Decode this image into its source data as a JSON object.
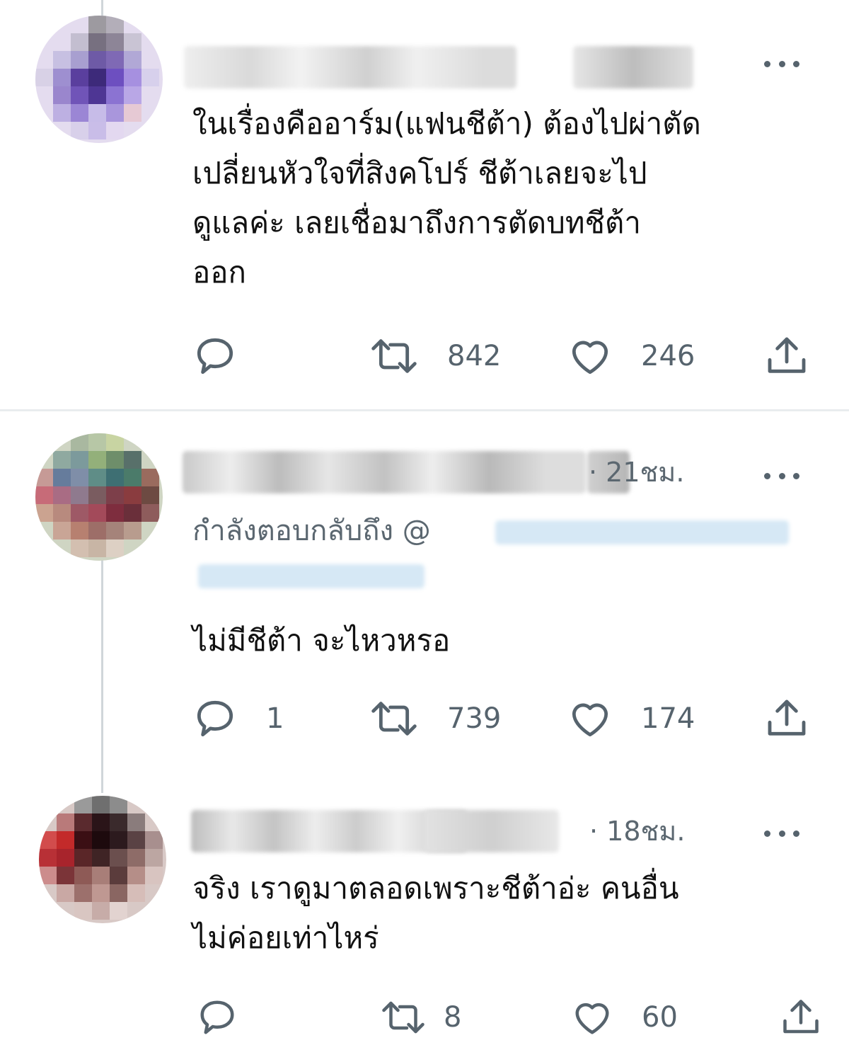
{
  "tweets": [
    {
      "time": "",
      "text": "ในเรื่องคืออาร์ม(แฟนชีต้า) ต้องไปผ่าตัด\nเปลี่ยนหัวใจที่สิงคโปร์ ชีต้าเลยจะไป\nดูแลค่ะ เลยเชื่อมาถึงการตัดบทชีต้า\nออก",
      "replies": "",
      "retweets": "842",
      "likes": "246"
    },
    {
      "time": "· 21ชม.",
      "reply_prefix": "กำลังตอบกลับถึง @",
      "text": "ไม่มีชีต้า  จะไหวหรอ",
      "replies": "1",
      "retweets": "739",
      "likes": "174"
    },
    {
      "time": "· 18ชม.",
      "text": "จริง เราดูมาตลอดเพราะชีต้าอ่ะ คนอื่น\nไม่ค่อยเท่าไหร่",
      "replies": "",
      "retweets": "8",
      "likes": "60"
    }
  ],
  "icons": {
    "reply": "speech-bubble-icon",
    "retweet": "retweet-arrows-icon",
    "like": "heart-icon",
    "share": "share-upload-icon",
    "more": "more-dots-icon"
  },
  "colors": {
    "icon_gray": "#56636d",
    "text": "#111111",
    "mention_blue": "#1d9bf0",
    "divider": "#e9ecee"
  }
}
